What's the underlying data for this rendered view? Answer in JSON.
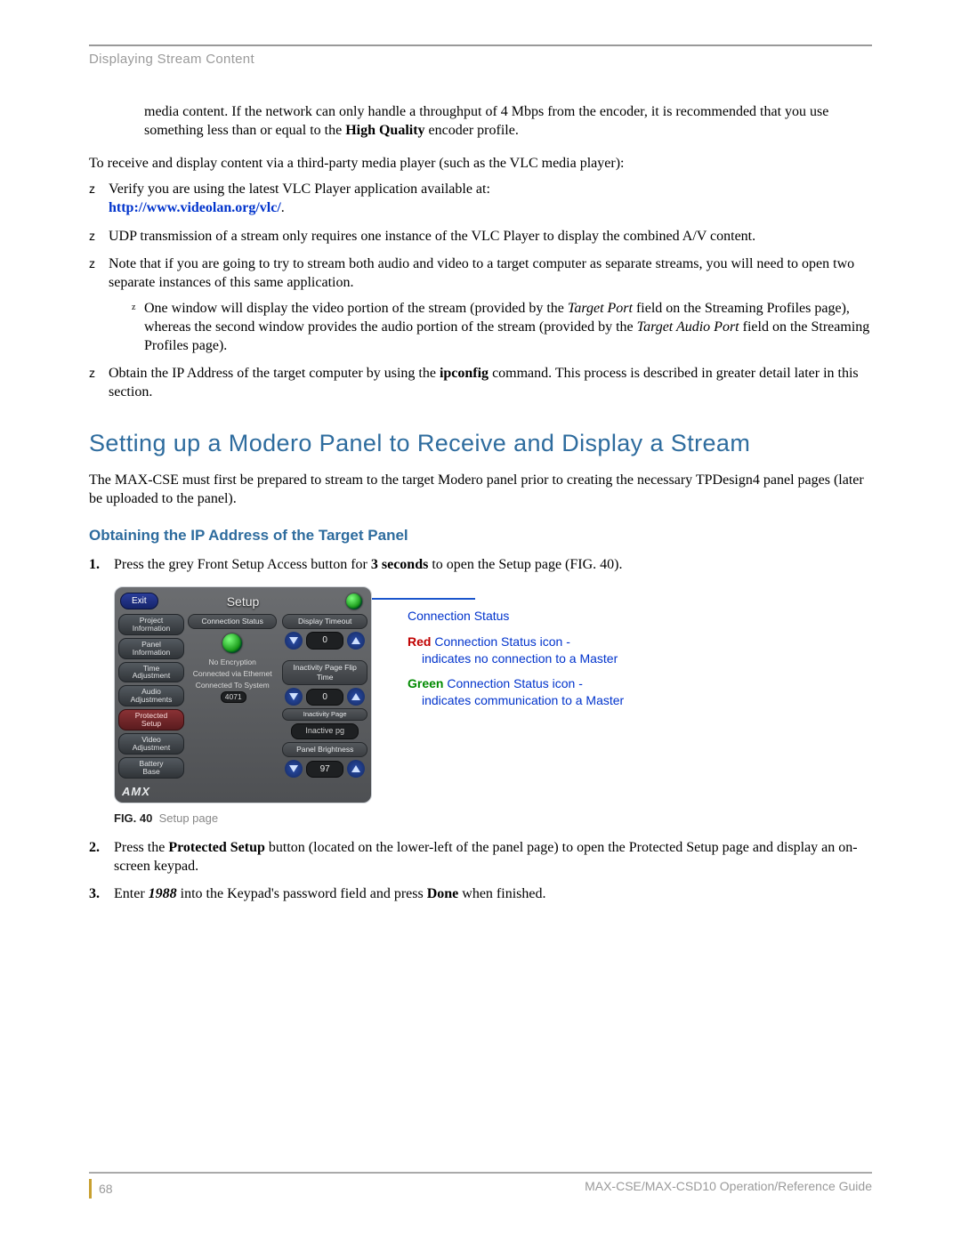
{
  "header": {
    "section": "Displaying Stream Content"
  },
  "intro": {
    "p1a": "media content. If the network can only handle a throughput of 4 Mbps from the encoder, it is recommended that you use something less than or equal to the ",
    "p1b_bold": "High Quality",
    "p1c": " encoder profile.",
    "p2": "To receive and display content via a third-party media player (such as the VLC media player):"
  },
  "bullets": {
    "b1a": "Verify you are using the latest VLC Player application available at: ",
    "b1_link": "http://www.videolan.org/vlc/",
    "b1b": ".",
    "b2": "UDP transmission of a stream only requires one instance of the VLC Player to display the combined A/V content.",
    "b3": "Note that if you are going to try to stream both audio and video to a target computer as separate streams, you will need to open two separate instances of this same application.",
    "b3_sub_a": "One window will display the video portion of the stream (provided by the ",
    "b3_sub_it1": "Target Port",
    "b3_sub_b": " field on the Streaming Profiles page), whereas the second window provides the audio portion of the stream (provided by the ",
    "b3_sub_it2": "Target Audio Port",
    "b3_sub_c": " field on the Streaming Profiles page).",
    "b4a": "Obtain the IP Address of the target computer by using the ",
    "b4_bold": "ipconfig",
    "b4b": " command. This process is described in greater detail later in this section."
  },
  "h2": "Setting up a Modero Panel to Receive and Display a Stream",
  "p_after_h2": "The MAX-CSE must first be prepared to stream to the target Modero panel prior to creating the necessary TPDesign4 panel pages (later be uploaded to the panel).",
  "h3": "Obtaining the IP Address of the Target Panel",
  "steps": {
    "s1a": "Press the grey Front Setup Access button for ",
    "s1_bold": "3 seconds",
    "s1b": " to open the Setup page (FIG. 40).",
    "s2a": "Press the ",
    "s2_bold": "Protected Setup",
    "s2b": " button (located on the lower-left of the panel page) to open the Protected Setup page and display an on-screen keypad.",
    "s3a": "Enter ",
    "s3_it": "1988",
    "s3b": " into the Keypad's password field and press ",
    "s3_bold": "Done",
    "s3c": " when finished."
  },
  "figure": {
    "title": "Setup",
    "exit": "Exit",
    "left_buttons": [
      "Project\nInformation",
      "Panel\nInformation",
      "Time\nAdjustment",
      "Audio\nAdjustments",
      "Protected\nSetup",
      "Video\nAdjustment",
      "Battery\nBase"
    ],
    "col1_cap": "Connection Status",
    "status_lines": {
      "l1": "No Encryption",
      "l2": "Connected via Ethernet",
      "l3a": "Connected To System",
      "l3b": "4071"
    },
    "col2_cap": "Display Timeout",
    "col2_val": "0",
    "row2_cap": "Inactivity Page Flip Time",
    "row2_val": "0",
    "inactive": "Inactive pg",
    "row3_cap": "Panel Brightness",
    "row3_val": "97",
    "logo": "AMX",
    "caption_label": "FIG. 40",
    "caption_text": "Setup page"
  },
  "annotations": {
    "title": "Connection Status",
    "red_label": "Red",
    "red_rest": " Connection Status icon -",
    "red_sub": "indicates no connection to a Master",
    "green_label": "Green",
    "green_rest": " Connection Status icon -",
    "green_sub": "indicates communication to a Master"
  },
  "footer": {
    "page": "68",
    "doc": "MAX-CSE/MAX-CSD10 Operation/Reference Guide"
  }
}
